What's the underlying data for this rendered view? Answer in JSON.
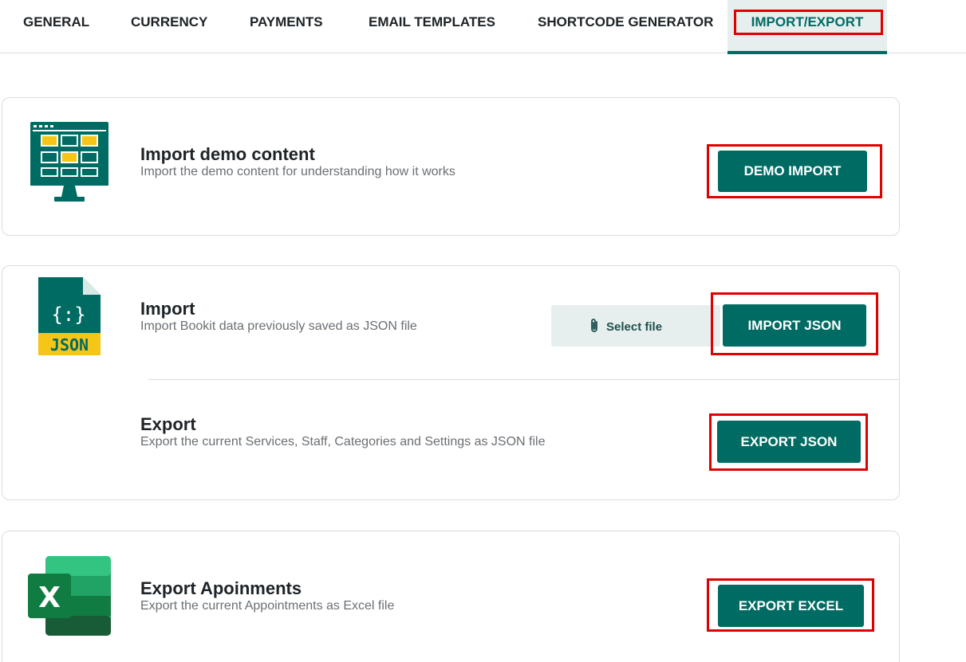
{
  "tabs": [
    {
      "label": "GENERAL"
    },
    {
      "label": "CURRENCY"
    },
    {
      "label": "PAYMENTS"
    },
    {
      "label": "EMAIL TEMPLATES"
    },
    {
      "label": "SHORTCODE GENERATOR"
    },
    {
      "label": "IMPORT/EXPORT",
      "active": true
    }
  ],
  "demo": {
    "title": "Import demo content",
    "description": "Import the demo content for understanding how it works",
    "button": "DEMO IMPORT",
    "icon": "monitor-dashboard-icon"
  },
  "import": {
    "title": "Import",
    "description": "Import Bookit data previously saved as JSON file",
    "select_file": "Select file",
    "button": "IMPORT JSON",
    "icon": "json-file-icon",
    "icon_text": "JSON"
  },
  "export": {
    "title": "Export",
    "description": "Export the current Services, Staff, Categories and Settings as JSON file",
    "button": "EXPORT JSON"
  },
  "excel": {
    "title": "Export Apoinments",
    "description": "Export the current Appointments as Excel file",
    "button": "EXPORT EXCEL",
    "icon": "excel-icon"
  },
  "colors": {
    "primary": "#006b63",
    "accent": "#f5c518",
    "highlight": "#e00000"
  }
}
